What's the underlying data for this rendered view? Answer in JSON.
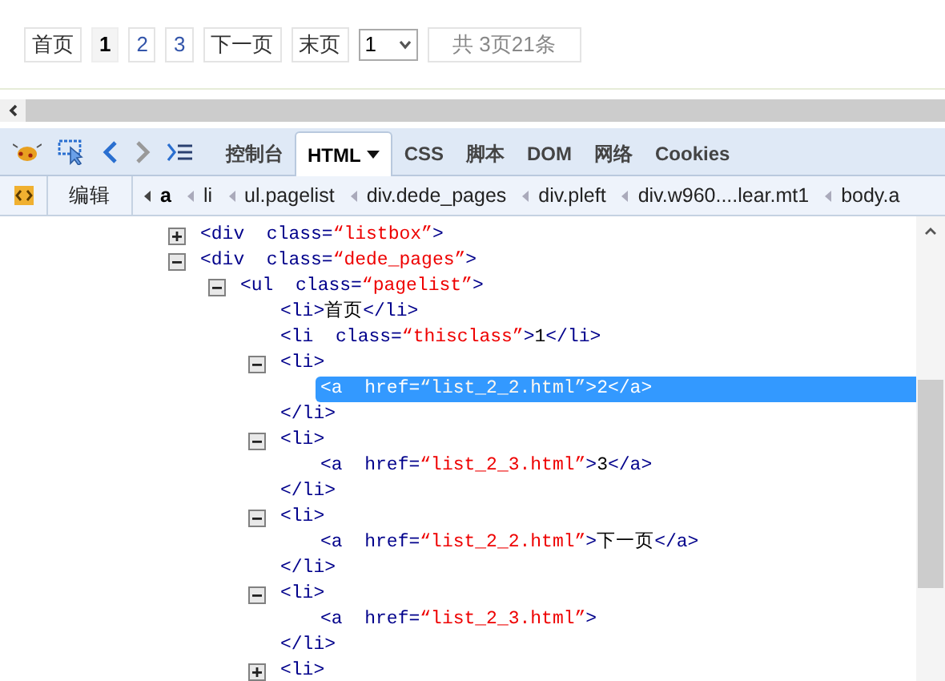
{
  "pagination": {
    "items": [
      {
        "label": "首页",
        "selected": false
      },
      {
        "label": "1",
        "selected": true
      },
      {
        "label": "2",
        "selected": false
      },
      {
        "label": "3",
        "selected": false
      },
      {
        "label": "下一页",
        "selected": false
      },
      {
        "label": "末页",
        "selected": false
      }
    ],
    "page_select": {
      "value": "1"
    },
    "summary": "共 3页21条"
  },
  "toolbar": {
    "tabs": [
      {
        "label": "控制台",
        "selected": false
      },
      {
        "label": "HTML",
        "selected": true
      },
      {
        "label": "CSS",
        "selected": false
      },
      {
        "label": "脚本",
        "selected": false
      },
      {
        "label": "DOM",
        "selected": false
      },
      {
        "label": "网络",
        "selected": false
      },
      {
        "label": "Cookies",
        "selected": false
      }
    ]
  },
  "breadcrumb": {
    "edit_button": "编辑",
    "crumbs": [
      {
        "label": "a",
        "selected": true
      },
      {
        "label": "li",
        "selected": false
      },
      {
        "label": "ul.pagelist",
        "selected": false
      },
      {
        "label": "div.dede_pages",
        "selected": false
      },
      {
        "label": "div.pleft",
        "selected": false
      },
      {
        "label": "div.w960....lear.mt1",
        "selected": false
      },
      {
        "label": "body.a",
        "selected": false
      }
    ]
  },
  "tree": [
    {
      "kind": "collapsed",
      "selected": false,
      "line": [
        {
          "kind": "tag",
          "text": "<div "
        },
        {
          "kind": "attr",
          "text": " class="
        },
        {
          "kind": "value",
          "text": "“listbox”"
        },
        {
          "kind": "tag",
          "text": ">"
        }
      ]
    },
    {
      "kind": "expanded",
      "selected": false,
      "line": [
        {
          "kind": "tag",
          "text": "<div "
        },
        {
          "kind": "attr",
          "text": " class="
        },
        {
          "kind": "value",
          "text": "“dede_pages”"
        },
        {
          "kind": "tag",
          "text": ">"
        }
      ],
      "children": [
        {
          "kind": "expanded",
          "selected": false,
          "line": [
            {
              "kind": "tag",
              "text": "<ul "
            },
            {
              "kind": "attr",
              "text": " class="
            },
            {
              "kind": "value",
              "text": "“pagelist”"
            },
            {
              "kind": "tag",
              "text": ">"
            }
          ],
          "children": [
            {
              "kind": "leaf",
              "selected": false,
              "line": [
                {
                  "kind": "tag",
                  "text": "<li>"
                },
                {
                  "kind": "text",
                  "text": "首页"
                },
                {
                  "kind": "tag",
                  "text": "</li>"
                }
              ]
            },
            {
              "kind": "leaf",
              "selected": false,
              "line": [
                {
                  "kind": "tag",
                  "text": "<li "
                },
                {
                  "kind": "attr",
                  "text": " class="
                },
                {
                  "kind": "value",
                  "text": "“thisclass”"
                },
                {
                  "kind": "tag",
                  "text": ">"
                },
                {
                  "kind": "text",
                  "text": "1"
                },
                {
                  "kind": "tag",
                  "text": "</li>"
                }
              ]
            },
            {
              "kind": "expanded",
              "selected": false,
              "line": [
                {
                  "kind": "tag",
                  "text": "<li>"
                }
              ],
              "children": [
                {
                  "kind": "leaf",
                  "selected": true,
                  "line": [
                    {
                      "kind": "tag",
                      "text": "<a "
                    },
                    {
                      "kind": "attr",
                      "text": " href="
                    },
                    {
                      "kind": "value",
                      "text": "“list_2_2.html”"
                    },
                    {
                      "kind": "tag",
                      "text": ">"
                    },
                    {
                      "kind": "text",
                      "text": "2"
                    },
                    {
                      "kind": "tag",
                      "text": "</a>"
                    }
                  ]
                }
              ],
              "closing": [
                {
                  "kind": "tag",
                  "text": "</li>"
                }
              ]
            },
            {
              "kind": "expanded",
              "selected": false,
              "line": [
                {
                  "kind": "tag",
                  "text": "<li>"
                }
              ],
              "children": [
                {
                  "kind": "leaf",
                  "selected": false,
                  "line": [
                    {
                      "kind": "tag",
                      "text": "<a "
                    },
                    {
                      "kind": "attr",
                      "text": " href="
                    },
                    {
                      "kind": "value",
                      "text": "“list_2_3.html”"
                    },
                    {
                      "kind": "tag",
                      "text": ">"
                    },
                    {
                      "kind": "text",
                      "text": "3"
                    },
                    {
                      "kind": "tag",
                      "text": "</a>"
                    }
                  ]
                }
              ],
              "closing": [
                {
                  "kind": "tag",
                  "text": "</li>"
                }
              ]
            },
            {
              "kind": "expanded",
              "selected": false,
              "line": [
                {
                  "kind": "tag",
                  "text": "<li>"
                }
              ],
              "children": [
                {
                  "kind": "leaf",
                  "selected": false,
                  "line": [
                    {
                      "kind": "tag",
                      "text": "<a "
                    },
                    {
                      "kind": "attr",
                      "text": " href="
                    },
                    {
                      "kind": "value",
                      "text": "“list_2_2.html”"
                    },
                    {
                      "kind": "tag",
                      "text": ">"
                    },
                    {
                      "kind": "text",
                      "text": "下一页"
                    },
                    {
                      "kind": "tag",
                      "text": "</a>"
                    }
                  ]
                }
              ],
              "closing": [
                {
                  "kind": "tag",
                  "text": "</li>"
                }
              ]
            },
            {
              "kind": "expanded",
              "selected": false,
              "line": [
                {
                  "kind": "tag",
                  "text": "<li>"
                }
              ],
              "children": [
                {
                  "kind": "leaf",
                  "selected": false,
                  "line": [
                    {
                      "kind": "tag",
                      "text": "<a "
                    },
                    {
                      "kind": "attr",
                      "text": " href="
                    },
                    {
                      "kind": "value",
                      "text": "“list_2_3.html”"
                    },
                    {
                      "kind": "tag",
                      "text": ">"
                    }
                  ]
                }
              ],
              "closing": [
                {
                  "kind": "tag",
                  "text": "</li>"
                }
              ]
            },
            {
              "kind": "collapsed",
              "selected": false,
              "line": [
                {
                  "kind": "tag",
                  "text": "<li>"
                }
              ]
            }
          ]
        }
      ]
    }
  ]
}
